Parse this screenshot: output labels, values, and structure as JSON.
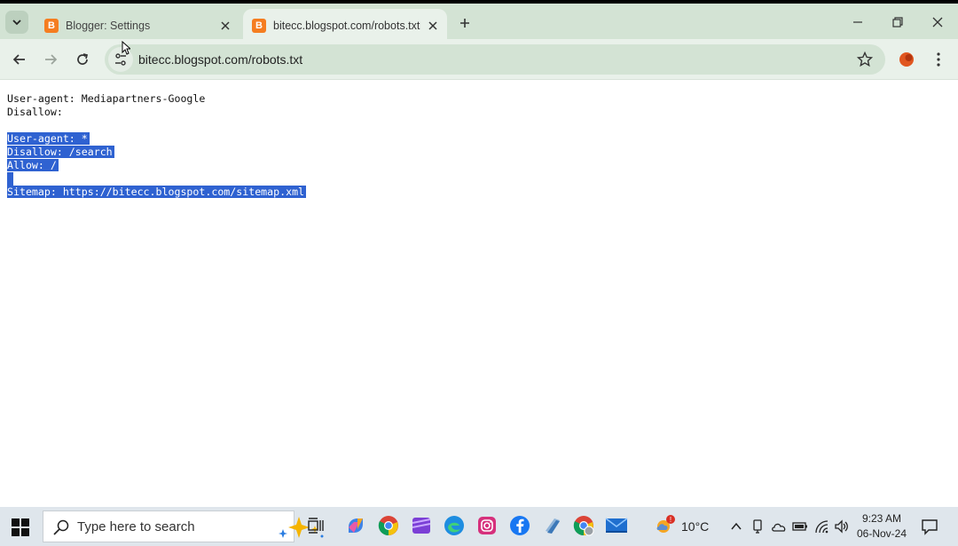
{
  "browser": {
    "tabs": [
      {
        "title": "Blogger: Settings",
        "active": false
      },
      {
        "title": "bitecc.blogspot.com/robots.txt",
        "active": true
      }
    ],
    "url": "bitecc.blogspot.com/robots.txt"
  },
  "robots_txt": {
    "lines": [
      {
        "text": "User-agent: Mediapartners-Google",
        "selected": false
      },
      {
        "text": "Disallow:",
        "selected": false
      },
      {
        "text": "",
        "selected": false
      },
      {
        "text": "User-agent: *",
        "selected": true
      },
      {
        "text": "Disallow: /search",
        "selected": true
      },
      {
        "text": "Allow: /",
        "selected": true
      },
      {
        "text": "",
        "selected": true
      },
      {
        "text": "Sitemap: https://bitecc.blogspot.com/sitemap.xml",
        "selected": true
      }
    ]
  },
  "taskbar": {
    "search_placeholder": "Type here to search",
    "weather_temp": "10°C",
    "time": "9:23 AM",
    "date": "06-Nov-24",
    "apps": [
      "copilot-icon",
      "chrome-icon",
      "clipchamp-icon",
      "edge-icon",
      "instagram-icon",
      "facebook-icon",
      "files-icon",
      "chrome-profile-icon",
      "mail-icon"
    ]
  },
  "colors": {
    "tab_strip": "#d3e3d4",
    "toolbar": "#e9f1ea",
    "selection": "#2f62d1",
    "blogger_orange": "#f57d20"
  }
}
